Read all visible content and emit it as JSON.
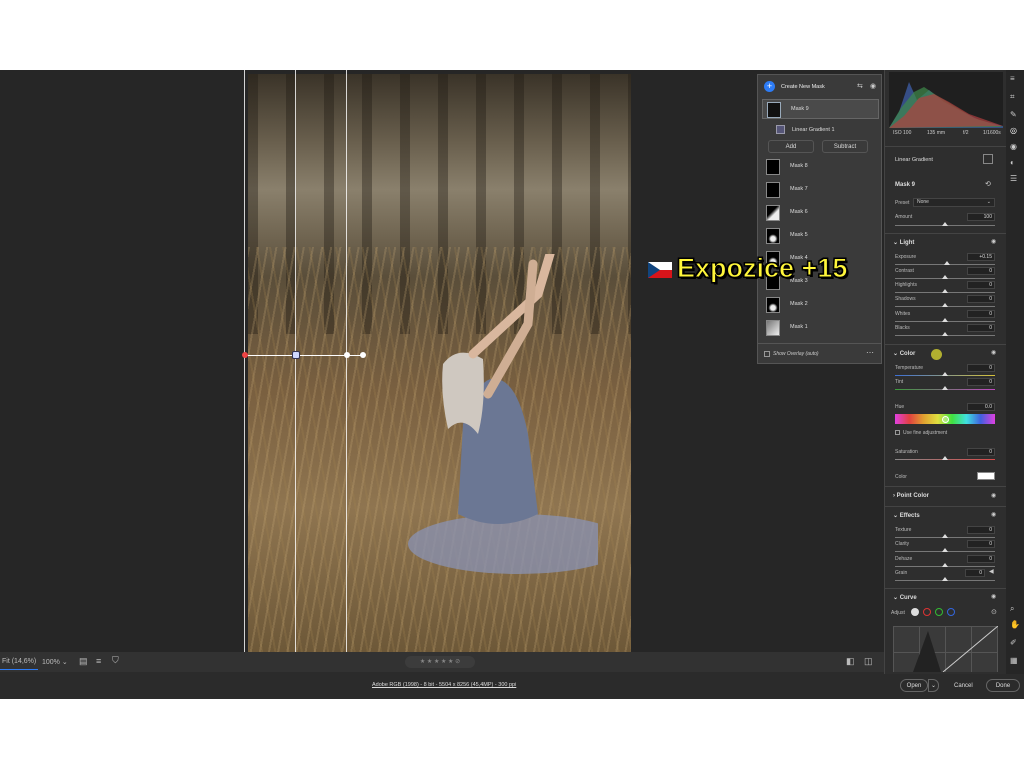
{
  "overlay": {
    "text": "Expozice +15"
  },
  "masks": {
    "create_label": "Create New Mask",
    "items": [
      "Mask 9",
      "Mask 8",
      "Mask 7",
      "Mask 6",
      "Mask 5",
      "Mask 4",
      "Mask 3",
      "Mask 2",
      "Mask 1"
    ],
    "sub_item": "Linear Gradient 1",
    "add_label": "Add",
    "subtract_label": "Subtract",
    "show_overlay": "Show Overlay (auto)"
  },
  "histogram": {
    "iso": "ISO 100",
    "focal": "135 mm",
    "aperture": "f/2",
    "shutter": "1/1600s"
  },
  "panel": {
    "linear_gradient": "Linear Gradient",
    "mask_name": "Mask 9",
    "preset_label": "Preset",
    "preset_value": "None",
    "amount_label": "Amount",
    "amount_value": "100",
    "light": {
      "title": "Light",
      "rows": [
        {
          "label": "Exposure",
          "value": "+0.15"
        },
        {
          "label": "Contrast",
          "value": "0"
        },
        {
          "label": "Highlights",
          "value": "0"
        },
        {
          "label": "Shadows",
          "value": "0"
        },
        {
          "label": "Whites",
          "value": "0"
        },
        {
          "label": "Blacks",
          "value": "0"
        }
      ]
    },
    "color": {
      "title": "Color",
      "temperature": {
        "label": "Temperature",
        "value": "0"
      },
      "tint": {
        "label": "Tint",
        "value": "0"
      },
      "hue": {
        "label": "Hue",
        "value": "0.0"
      },
      "fine_adjust": "Use fine adjustment",
      "saturation": {
        "label": "Saturation",
        "value": "0"
      },
      "color_label": "Color"
    },
    "point_color": {
      "title": "Point Color"
    },
    "effects": {
      "title": "Effects",
      "rows": [
        {
          "label": "Texture",
          "value": "0"
        },
        {
          "label": "Clarity",
          "value": "0"
        },
        {
          "label": "Dehaze",
          "value": "0"
        },
        {
          "label": "Grain",
          "value": "0"
        }
      ]
    },
    "curve": {
      "title": "Curve",
      "adjust_label": "Adjust"
    }
  },
  "toolbar": {
    "fit": "Fit (14,6%)",
    "zoom": "100%",
    "stars": "★ ★ ★ ★ ★"
  },
  "footer": {
    "file_info": "Adobe RGB (1998) - 8 bit - 5504 x 8256 (45,4MP) - 300 ppi",
    "open": "Open",
    "cancel": "Cancel",
    "done": "Done"
  }
}
